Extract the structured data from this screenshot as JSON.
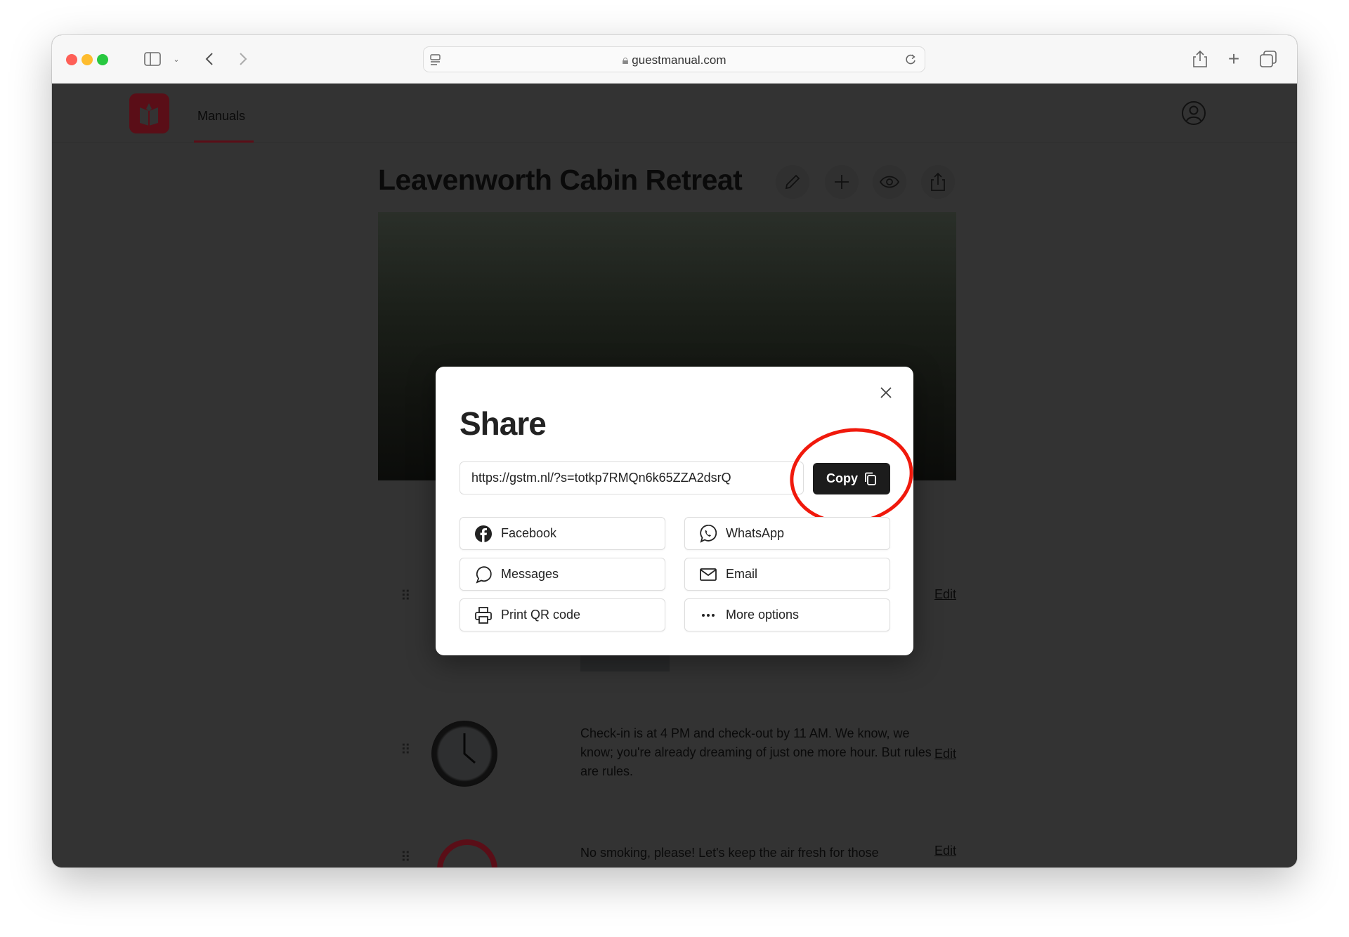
{
  "browser": {
    "url": "guestmanual.com"
  },
  "nav": {
    "link": "Manuals"
  },
  "manual": {
    "title": "Leavenworth Cabin Retreat"
  },
  "rows": [
    {
      "text": "Check-in is at 4 PM and check-out by 11 AM. We know, we know; you're already dreaming of just one more hour. But rules are rules.",
      "edit": "Edit"
    },
    {
      "text": "No smoking, please! Let's keep the air fresh for those",
      "edit": "Edit"
    }
  ],
  "row0_edit": "Edit",
  "share": {
    "title": "Share",
    "url": "https://gstm.nl/?s=totkp7RMQn6k65ZZA2dsrQ",
    "copy_label": "Copy",
    "options": [
      "Facebook",
      "WhatsApp",
      "Messages",
      "Email",
      "Print QR code",
      "More options"
    ]
  },
  "colors": {
    "brand": "#a3192a",
    "annotation": "#f0190c",
    "copy_button": "#1c1c1c"
  }
}
